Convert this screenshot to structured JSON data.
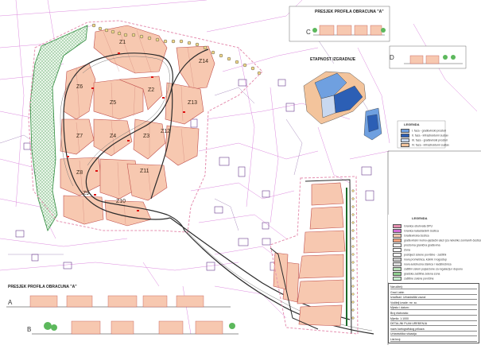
{
  "sections": {
    "top_title": "PRESJEK PROFILA OBRACUNA \"A\"",
    "bottom_title": "PRESJEK PROFILA OBRACUNA \"A\"",
    "labels": [
      "A",
      "B",
      "C",
      "D"
    ]
  },
  "phases": {
    "title": "ETAPNOST IZGRADNJE",
    "legend_title": "LEGENDA",
    "items": [
      {
        "label": "I. faza - građevinski prostori",
        "color": "#6fa0e0"
      },
      {
        "label": "II. faza - infrastrukturni sustav",
        "color": "#2c5fb5"
      },
      {
        "label": "III. faza - građevinski prostori",
        "color": "#c8d8f0"
      },
      {
        "label": "IV. faza - infrastrukturni sustav",
        "color": "#f3c49c"
      }
    ]
  },
  "zones": [
    "Z1",
    "Z2",
    "Z3",
    "Z4",
    "Z5",
    "Z6",
    "Z7",
    "Z8",
    "Z9",
    "Z10",
    "Z11",
    "Z12",
    "Z13",
    "Z14"
  ],
  "legend": {
    "title": "LEGENDA",
    "items": [
      {
        "label": "Granica obuhvata DPU",
        "color": "#e58fb0"
      },
      {
        "label": "Granica katastarskih čestica",
        "color": "#d36bd6"
      },
      {
        "label": "Građevinska čestica",
        "color": "#f7c8b0"
      },
      {
        "label": "građevinski i kolno-pješački ulazi (za nekoliko zoniranih čestica)",
        "color": "#f5a37f"
      },
      {
        "label": "prostorna granična građevina",
        "color": "#ffffff"
      },
      {
        "label": "Zona",
        "color": "#ffffff"
      },
      {
        "label": "postojeći zelene površine - zaštitni",
        "color": "#ffffff"
      },
      {
        "label": "nova prometnica, kolnik i nogostup",
        "color": "#d0d0d0"
      },
      {
        "label": "nova autobusna stanica i nadstrešnica",
        "color": "#e0e0e0"
      },
      {
        "label": "zaštitni zeleni pojas/zone za regulaciju i dopunu",
        "color": "#b8e0b8"
      },
      {
        "label": "gradska zaštitna zelena zona",
        "color": "#8fd08f"
      },
      {
        "label": "zaštitne zelene površine",
        "color": "#c8f0d0"
      }
    ]
  },
  "title_block": {
    "rows": [
      "Naručitelj:",
      "Grad Labin",
      "Izrađivač: Urbanistički zavod",
      "Voditelj izrade: mr. sc.",
      "Mjesto i datum:",
      "Broj elaborata:",
      "Mjerilo: 1:1000",
      "DETALJNI PLAN UREĐENJA",
      "naziv kartografskog prikaza",
      "Urbanistička situacija",
      "List broj:"
    ]
  }
}
